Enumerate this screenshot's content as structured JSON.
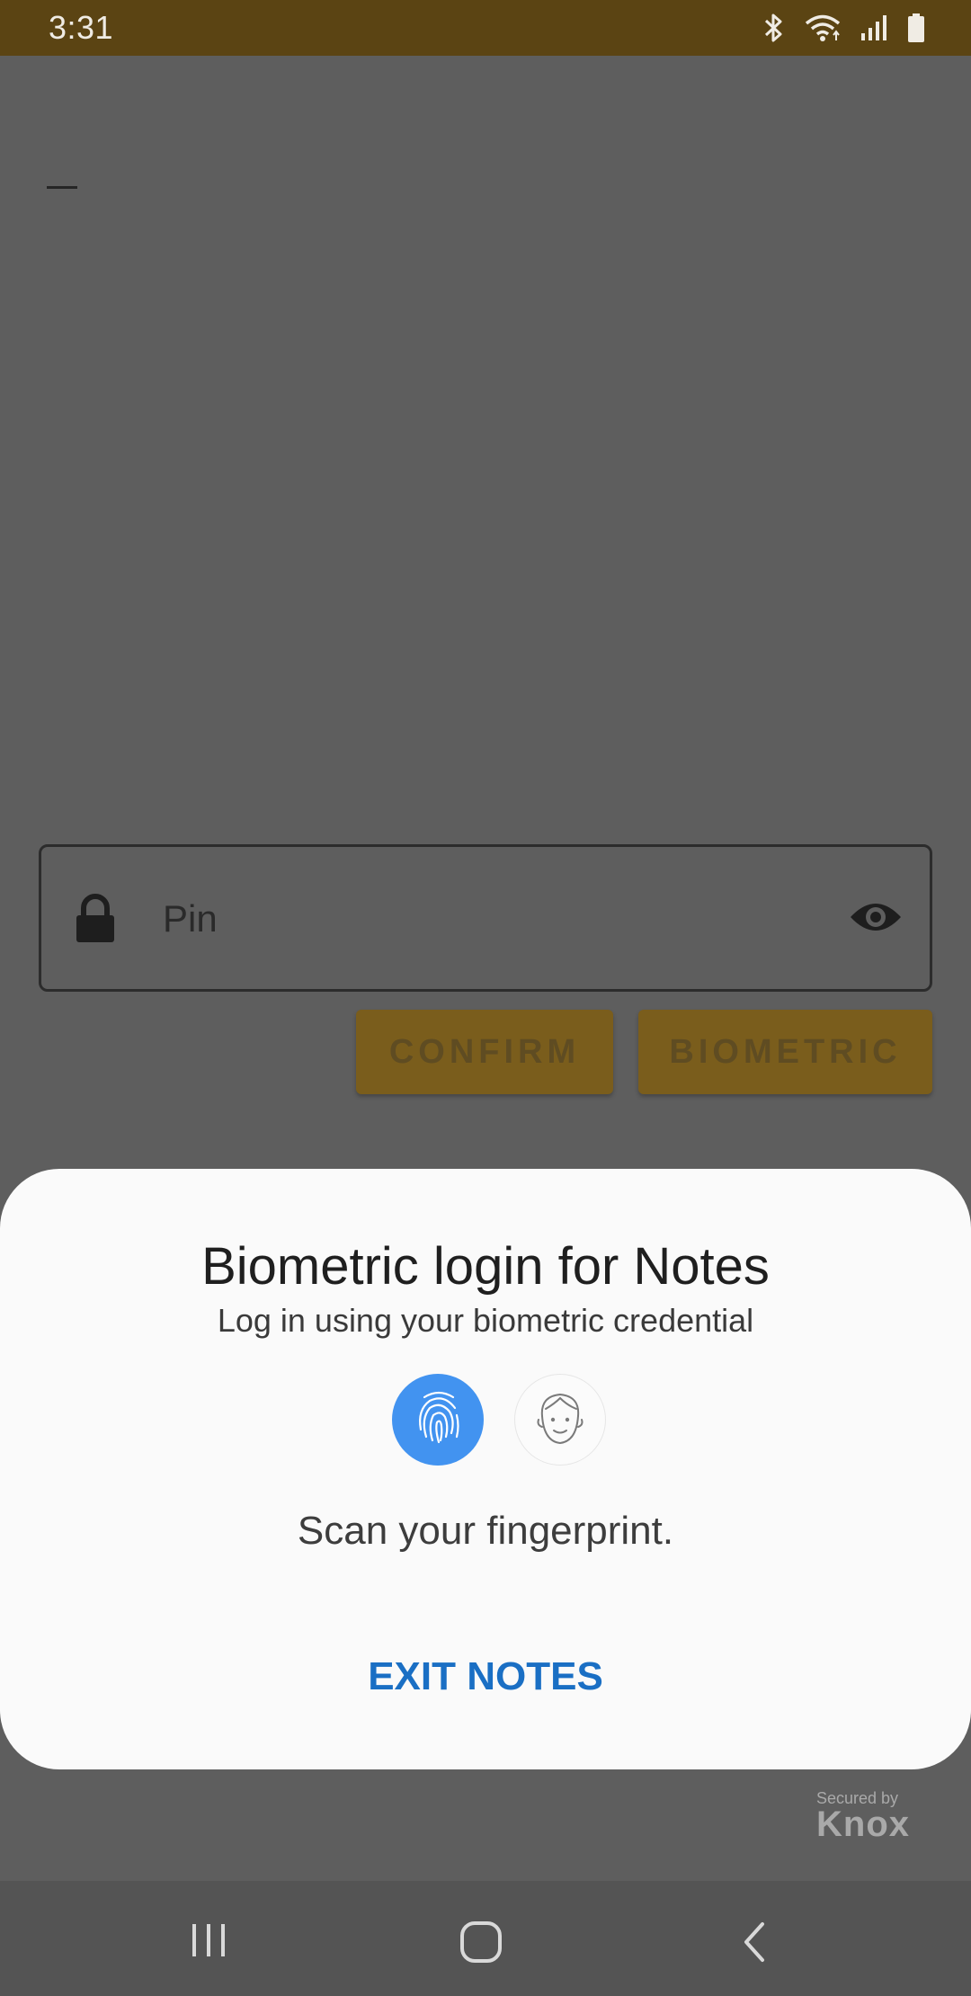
{
  "status_bar": {
    "time": "3:31",
    "icons": [
      "bluetooth-icon",
      "wifi-icon",
      "signal-icon",
      "battery-icon"
    ],
    "background": "#5b4413"
  },
  "app": {
    "pin_field": {
      "placeholder": "Pin",
      "leading_icon": "lock-icon",
      "trailing_icon": "eye-icon"
    },
    "buttons": {
      "confirm_label": "CONFIRM",
      "biometric_label": "BIOMETRIC"
    },
    "accent_color": "#7a5d1c"
  },
  "biometric_sheet": {
    "title": "Biometric login for Notes",
    "subtitle": "Log in using your biometric credential",
    "options": [
      "fingerprint-icon",
      "face-icon"
    ],
    "selected_option": "fingerprint-icon",
    "instruction": "Scan your fingerprint.",
    "exit_label": "EXIT NOTES",
    "exit_color": "#1a6fc4",
    "selected_color": "#4293f0"
  },
  "knox_badge": {
    "small_text": "Secured by",
    "brand_text": "Knox"
  },
  "nav_bar": {
    "icons": [
      "recents-icon",
      "home-icon",
      "back-icon"
    ]
  }
}
